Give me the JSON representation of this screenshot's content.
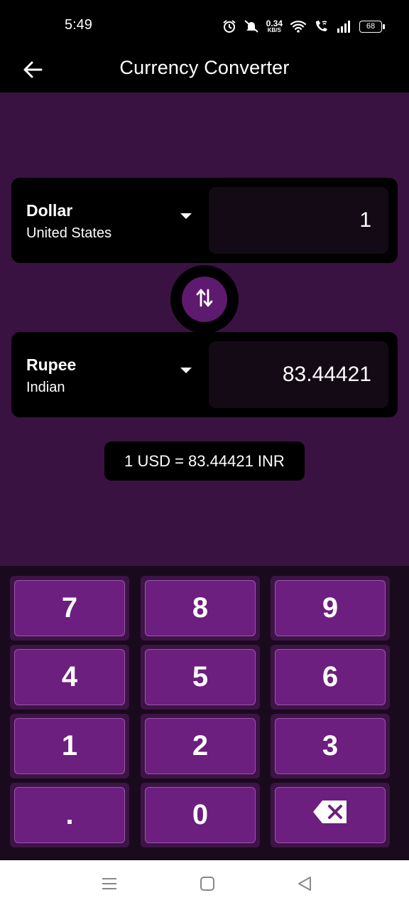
{
  "status_bar": {
    "time": "5:49",
    "speed_value": "0.34",
    "speed_unit": "KB/S",
    "battery": "68",
    "icons": [
      "alarm-icon",
      "mute-icon",
      "wifi-icon",
      "wifi-call-icon",
      "signal-icon",
      "battery-icon"
    ]
  },
  "app_bar": {
    "title": "Currency Converter",
    "back_icon": "arrow-left-icon"
  },
  "from_currency": {
    "name": "Dollar",
    "country": "United States",
    "amount": "1"
  },
  "to_currency": {
    "name": "Rupee",
    "country": "Indian",
    "amount": "83.44421"
  },
  "swap_icon": "swap-vertical-icon",
  "rate_text": "1 USD = 83.44421 INR",
  "keypad": {
    "keys": [
      "7",
      "8",
      "9",
      "4",
      "5",
      "6",
      "1",
      "2",
      "3",
      ".",
      "0",
      "backspace"
    ]
  },
  "colors": {
    "background": "#3a1242",
    "card": "#000000",
    "key": "#6c1f7e",
    "keypad_bg": "#1a0a1d",
    "swap_button": "#5e1a6e"
  },
  "nav_bar": {
    "icons": [
      "menu-icon",
      "home-icon",
      "back-icon"
    ]
  }
}
